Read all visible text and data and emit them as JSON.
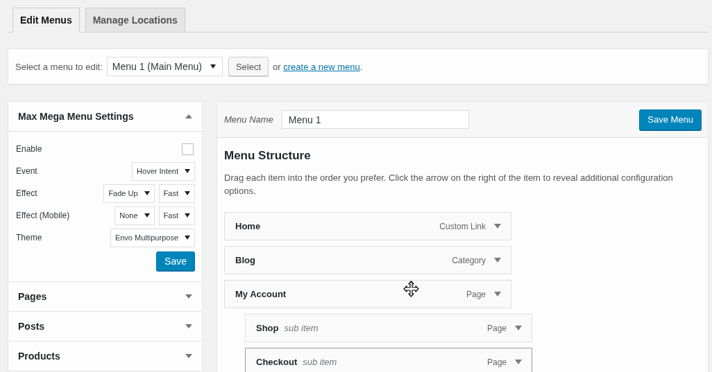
{
  "tabs": [
    {
      "label": "Edit Menus",
      "selected": true
    },
    {
      "label": "Manage Locations",
      "selected": false
    }
  ],
  "menu_picker": {
    "label": "Select a menu to edit:",
    "value": "Menu 1 (Main Menu)",
    "button": "Select",
    "prefix": "or",
    "link": "create a new menu",
    "suffix": "."
  },
  "accordions": [
    {
      "title": "Max Mega Menu Settings",
      "expanded": true,
      "fields": [
        {
          "kind": "checkbox",
          "label": "Enable",
          "checked": false
        },
        {
          "kind": "select",
          "label": "Event",
          "values": [
            "Hover Intent"
          ]
        },
        {
          "kind": "select",
          "label": "Effect",
          "values": [
            "Fade Up",
            "Fast"
          ]
        },
        {
          "kind": "select",
          "label": "Effect (Mobile)",
          "values": [
            "None",
            "Fast"
          ]
        },
        {
          "kind": "select",
          "label": "Theme",
          "values": [
            "Envo Multipurpose"
          ]
        }
      ],
      "button": "Save"
    },
    {
      "title": "Pages",
      "expanded": false
    },
    {
      "title": "Posts",
      "expanded": false
    },
    {
      "title": "Products",
      "expanded": false
    }
  ],
  "menu_editor": {
    "name_label": "Menu Name",
    "name": "Menu 1",
    "save_button": "Save Menu",
    "heading": "Menu Structure",
    "description": "Drag each item into the order you prefer. Click the arrow on the right of the item to reveal additional configuration options.",
    "items": [
      {
        "title": "Home",
        "type": "Custom Link",
        "highlighted": false
      },
      {
        "title": "Blog",
        "type": "Category",
        "highlighted": false
      },
      {
        "title": "My Account",
        "type": "Page",
        "highlighted": false,
        "children": [
          {
            "title": "Shop",
            "note": "sub item",
            "type": "Page",
            "highlighted": false
          },
          {
            "title": "Checkout",
            "note": "sub item",
            "type": "Page",
            "highlighted": true
          }
        ]
      }
    ]
  }
}
